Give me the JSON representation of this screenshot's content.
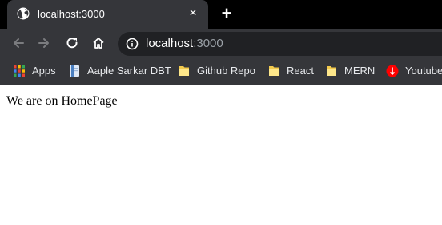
{
  "tab": {
    "title": "localhost:3000",
    "favicon": "globe-icon",
    "close": "×"
  },
  "new_tab": "+",
  "toolbar": {
    "back_icon": "arrow-left-icon",
    "forward_icon": "arrow-right-icon",
    "reload_icon": "reload-icon",
    "home_icon": "home-icon"
  },
  "omnibox": {
    "info_icon": "info-icon",
    "host": "localhost",
    "port": ":3000"
  },
  "bookmarks": [
    {
      "label": "Apps",
      "icon": "apps-grid-icon"
    },
    {
      "label": "Aaple Sarkar DBT",
      "icon": "page-icon"
    },
    {
      "label": "Github Repo",
      "icon": "folder-icon"
    },
    {
      "label": "React",
      "icon": "folder-icon"
    },
    {
      "label": "MERN",
      "icon": "folder-icon"
    },
    {
      "label": "Youtube",
      "icon": "youtube-icon"
    }
  ],
  "page": {
    "text": "We are on HomePage"
  },
  "colors": {
    "tabstrip": "#000000",
    "toolbar": "#35363a",
    "omnibox": "#202124",
    "text_light": "#e8eaed",
    "port_gray": "#9aa0a6",
    "youtube_red": "#ff0000"
  }
}
